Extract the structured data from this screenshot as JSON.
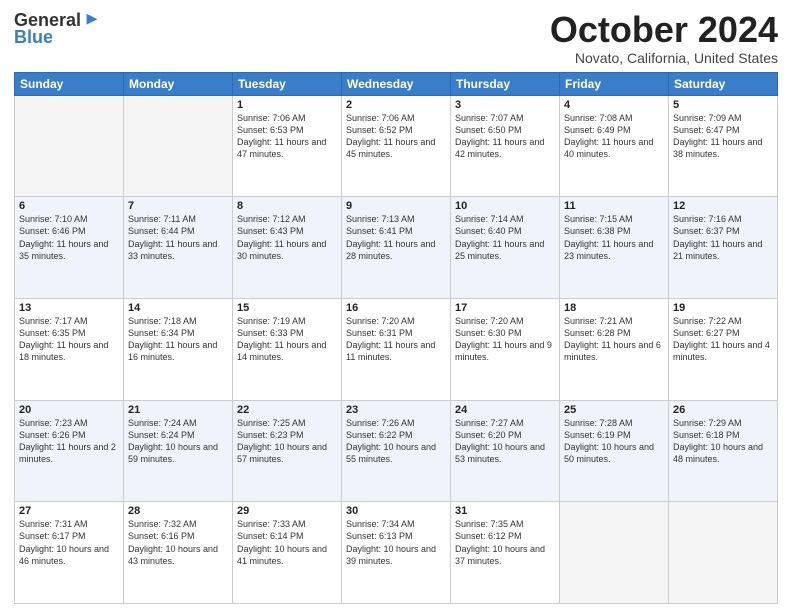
{
  "logo": {
    "general": "General",
    "blue": "Blue"
  },
  "title": {
    "month": "October 2024",
    "location": "Novato, California, United States"
  },
  "days_header": [
    "Sunday",
    "Monday",
    "Tuesday",
    "Wednesday",
    "Thursday",
    "Friday",
    "Saturday"
  ],
  "weeks": [
    [
      {
        "num": "",
        "sunrise": "",
        "sunset": "",
        "daylight": "",
        "empty": true
      },
      {
        "num": "",
        "sunrise": "",
        "sunset": "",
        "daylight": "",
        "empty": true
      },
      {
        "num": "1",
        "sunrise": "Sunrise: 7:06 AM",
        "sunset": "Sunset: 6:53 PM",
        "daylight": "Daylight: 11 hours and 47 minutes."
      },
      {
        "num": "2",
        "sunrise": "Sunrise: 7:06 AM",
        "sunset": "Sunset: 6:52 PM",
        "daylight": "Daylight: 11 hours and 45 minutes."
      },
      {
        "num": "3",
        "sunrise": "Sunrise: 7:07 AM",
        "sunset": "Sunset: 6:50 PM",
        "daylight": "Daylight: 11 hours and 42 minutes."
      },
      {
        "num": "4",
        "sunrise": "Sunrise: 7:08 AM",
        "sunset": "Sunset: 6:49 PM",
        "daylight": "Daylight: 11 hours and 40 minutes."
      },
      {
        "num": "5",
        "sunrise": "Sunrise: 7:09 AM",
        "sunset": "Sunset: 6:47 PM",
        "daylight": "Daylight: 11 hours and 38 minutes."
      }
    ],
    [
      {
        "num": "6",
        "sunrise": "Sunrise: 7:10 AM",
        "sunset": "Sunset: 6:46 PM",
        "daylight": "Daylight: 11 hours and 35 minutes."
      },
      {
        "num": "7",
        "sunrise": "Sunrise: 7:11 AM",
        "sunset": "Sunset: 6:44 PM",
        "daylight": "Daylight: 11 hours and 33 minutes."
      },
      {
        "num": "8",
        "sunrise": "Sunrise: 7:12 AM",
        "sunset": "Sunset: 6:43 PM",
        "daylight": "Daylight: 11 hours and 30 minutes."
      },
      {
        "num": "9",
        "sunrise": "Sunrise: 7:13 AM",
        "sunset": "Sunset: 6:41 PM",
        "daylight": "Daylight: 11 hours and 28 minutes."
      },
      {
        "num": "10",
        "sunrise": "Sunrise: 7:14 AM",
        "sunset": "Sunset: 6:40 PM",
        "daylight": "Daylight: 11 hours and 25 minutes."
      },
      {
        "num": "11",
        "sunrise": "Sunrise: 7:15 AM",
        "sunset": "Sunset: 6:38 PM",
        "daylight": "Daylight: 11 hours and 23 minutes."
      },
      {
        "num": "12",
        "sunrise": "Sunrise: 7:16 AM",
        "sunset": "Sunset: 6:37 PM",
        "daylight": "Daylight: 11 hours and 21 minutes."
      }
    ],
    [
      {
        "num": "13",
        "sunrise": "Sunrise: 7:17 AM",
        "sunset": "Sunset: 6:35 PM",
        "daylight": "Daylight: 11 hours and 18 minutes."
      },
      {
        "num": "14",
        "sunrise": "Sunrise: 7:18 AM",
        "sunset": "Sunset: 6:34 PM",
        "daylight": "Daylight: 11 hours and 16 minutes."
      },
      {
        "num": "15",
        "sunrise": "Sunrise: 7:19 AM",
        "sunset": "Sunset: 6:33 PM",
        "daylight": "Daylight: 11 hours and 14 minutes."
      },
      {
        "num": "16",
        "sunrise": "Sunrise: 7:20 AM",
        "sunset": "Sunset: 6:31 PM",
        "daylight": "Daylight: 11 hours and 11 minutes."
      },
      {
        "num": "17",
        "sunrise": "Sunrise: 7:20 AM",
        "sunset": "Sunset: 6:30 PM",
        "daylight": "Daylight: 11 hours and 9 minutes."
      },
      {
        "num": "18",
        "sunrise": "Sunrise: 7:21 AM",
        "sunset": "Sunset: 6:28 PM",
        "daylight": "Daylight: 11 hours and 6 minutes."
      },
      {
        "num": "19",
        "sunrise": "Sunrise: 7:22 AM",
        "sunset": "Sunset: 6:27 PM",
        "daylight": "Daylight: 11 hours and 4 minutes."
      }
    ],
    [
      {
        "num": "20",
        "sunrise": "Sunrise: 7:23 AM",
        "sunset": "Sunset: 6:26 PM",
        "daylight": "Daylight: 11 hours and 2 minutes."
      },
      {
        "num": "21",
        "sunrise": "Sunrise: 7:24 AM",
        "sunset": "Sunset: 6:24 PM",
        "daylight": "Daylight: 10 hours and 59 minutes."
      },
      {
        "num": "22",
        "sunrise": "Sunrise: 7:25 AM",
        "sunset": "Sunset: 6:23 PM",
        "daylight": "Daylight: 10 hours and 57 minutes."
      },
      {
        "num": "23",
        "sunrise": "Sunrise: 7:26 AM",
        "sunset": "Sunset: 6:22 PM",
        "daylight": "Daylight: 10 hours and 55 minutes."
      },
      {
        "num": "24",
        "sunrise": "Sunrise: 7:27 AM",
        "sunset": "Sunset: 6:20 PM",
        "daylight": "Daylight: 10 hours and 53 minutes."
      },
      {
        "num": "25",
        "sunrise": "Sunrise: 7:28 AM",
        "sunset": "Sunset: 6:19 PM",
        "daylight": "Daylight: 10 hours and 50 minutes."
      },
      {
        "num": "26",
        "sunrise": "Sunrise: 7:29 AM",
        "sunset": "Sunset: 6:18 PM",
        "daylight": "Daylight: 10 hours and 48 minutes."
      }
    ],
    [
      {
        "num": "27",
        "sunrise": "Sunrise: 7:31 AM",
        "sunset": "Sunset: 6:17 PM",
        "daylight": "Daylight: 10 hours and 46 minutes."
      },
      {
        "num": "28",
        "sunrise": "Sunrise: 7:32 AM",
        "sunset": "Sunset: 6:16 PM",
        "daylight": "Daylight: 10 hours and 43 minutes."
      },
      {
        "num": "29",
        "sunrise": "Sunrise: 7:33 AM",
        "sunset": "Sunset: 6:14 PM",
        "daylight": "Daylight: 10 hours and 41 minutes."
      },
      {
        "num": "30",
        "sunrise": "Sunrise: 7:34 AM",
        "sunset": "Sunset: 6:13 PM",
        "daylight": "Daylight: 10 hours and 39 minutes."
      },
      {
        "num": "31",
        "sunrise": "Sunrise: 7:35 AM",
        "sunset": "Sunset: 6:12 PM",
        "daylight": "Daylight: 10 hours and 37 minutes."
      },
      {
        "num": "",
        "sunrise": "",
        "sunset": "",
        "daylight": "",
        "empty": true
      },
      {
        "num": "",
        "sunrise": "",
        "sunset": "",
        "daylight": "",
        "empty": true
      }
    ]
  ]
}
